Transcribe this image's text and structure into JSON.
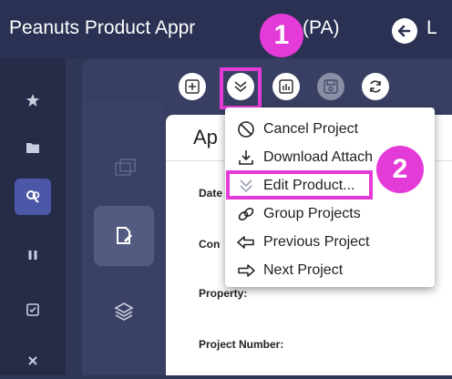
{
  "header": {
    "title": "Peanuts Product Appr",
    "title_suffix": "(PA)",
    "title_tail": "L",
    "back_icon": "arrow-left-circle-icon"
  },
  "callouts": {
    "step1": "1",
    "step2": "2",
    "color": "#e43bd8"
  },
  "sidebar": {
    "items": [
      {
        "icon": "star-icon"
      },
      {
        "icon": "folder-icon"
      },
      {
        "icon": "people-icon",
        "active": true
      },
      {
        "icon": "pause-icon"
      },
      {
        "icon": "checkbox-icon"
      },
      {
        "icon": "close-icon"
      }
    ]
  },
  "toolbar": {
    "buttons": [
      {
        "icon": "add-box-icon"
      },
      {
        "icon": "chevron-double-down-icon",
        "highlighted": true
      },
      {
        "icon": "bar-chart-icon"
      },
      {
        "icon": "save-icon",
        "disabled": true
      },
      {
        "icon": "refresh-icon"
      }
    ]
  },
  "content": {
    "title": "Ap",
    "fields": {
      "date": "Date",
      "con": "Con",
      "property": "Property:",
      "project_number": "Project Number:"
    }
  },
  "menu": {
    "items": [
      {
        "label": "Cancel Project",
        "icon": "cancel-circle-icon"
      },
      {
        "label": "Download Attach",
        "icon": "download-icon"
      },
      {
        "label": "Edit Product...",
        "icon": "chevron-double-down-icon",
        "highlighted": true
      },
      {
        "label": "Group Projects",
        "icon": "link-icon"
      },
      {
        "label": "Previous Project",
        "icon": "arrow-left-outline-icon"
      },
      {
        "label": "Next Project",
        "icon": "arrow-right-outline-icon"
      }
    ]
  },
  "colors": {
    "sidebar_bg": "#262c48",
    "topbar_bg": "#2a3152",
    "active_item": "#4b58a8",
    "highlight": "#e43bd8"
  }
}
